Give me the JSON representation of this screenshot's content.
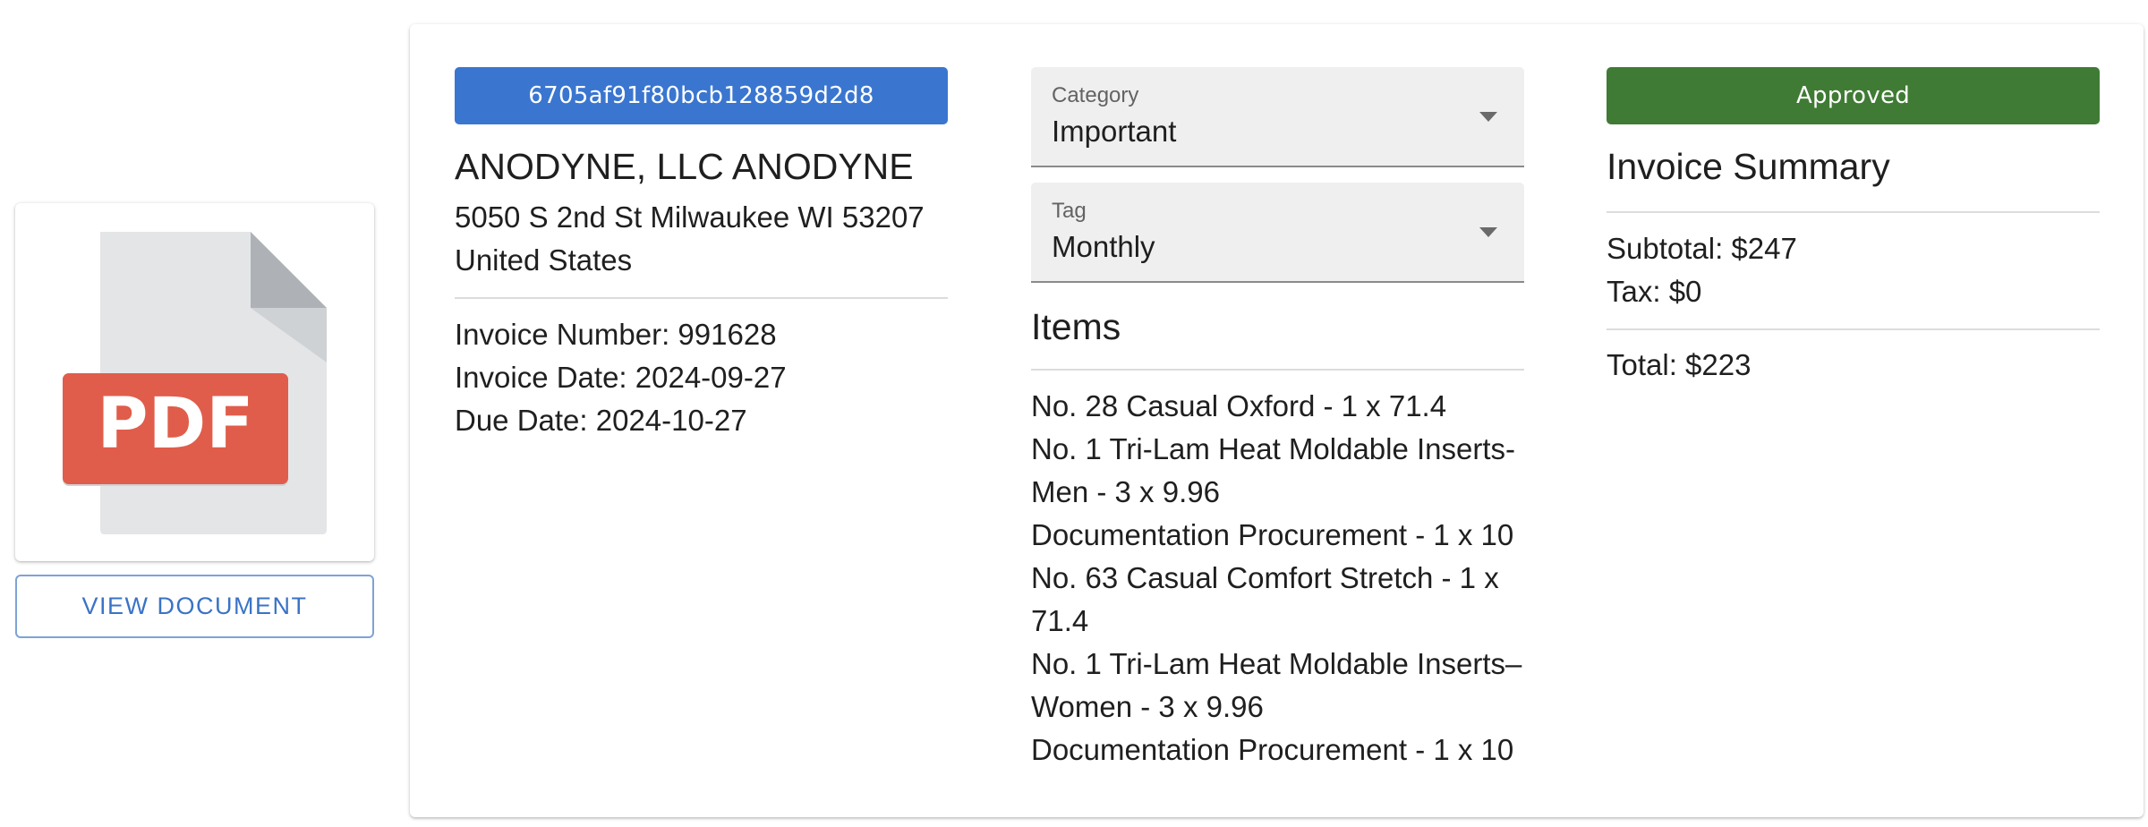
{
  "document": {
    "preview_icon": "pdf-file-icon",
    "pdf_label": "PDF",
    "view_button_label": "VIEW DOCUMENT"
  },
  "invoice": {
    "id": "6705af91f80bcb128859d2d8",
    "status": "Approved",
    "vendor_name": "ANODYNE, LLC ANODYNE",
    "address_line1": "5050 S 2nd St Milwaukee WI 53207",
    "address_line2": "United States",
    "invoice_number": "Invoice Number: 991628",
    "invoice_date": "Invoice Date: 2024-09-27",
    "due_date": "Due Date: 2024-10-27"
  },
  "fields": {
    "category": {
      "label": "Category",
      "value": "Important"
    },
    "tag": {
      "label": "Tag",
      "value": "Monthly"
    }
  },
  "items": {
    "title": "Items",
    "lines": [
      "No. 28 Casual Oxford - 1 x 71.4",
      "No. 1 Tri-Lam Heat Moldable Inserts-",
      "Men - 3 x 9.96",
      "Documentation Procurement - 1 x 10",
      "No. 63 Casual Comfort Stretch - 1 x",
      "71.4",
      "No. 1 Tri-Lam Heat Moldable Inserts–",
      "Women - 3 x 9.96",
      "Documentation Procurement - 1 x 10"
    ]
  },
  "summary": {
    "title": "Invoice Summary",
    "subtotal": "Subtotal: $247",
    "tax": "Tax: $0",
    "total": "Total: $223"
  },
  "colors": {
    "id_chip": "#3a76d0",
    "status_chip": "#3f7b34",
    "pdf_badge": "#e05d4b",
    "view_button_text": "#3a73c6"
  }
}
